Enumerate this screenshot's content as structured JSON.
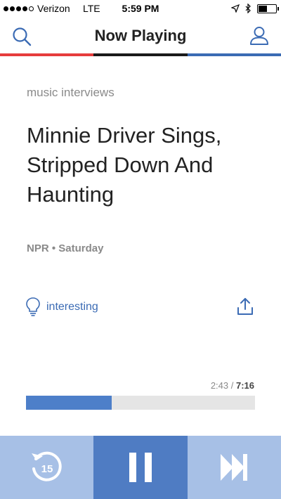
{
  "status_bar": {
    "carrier": "Verizon",
    "network": "LTE",
    "time": "5:59 PM",
    "signal_bars": 4,
    "battery_level": 0.45
  },
  "nav": {
    "title": "Now Playing",
    "search_icon": "search-icon",
    "user_icon": "user-icon",
    "stripe_colors": [
      "#e63c3c",
      "#1a1a1a",
      "#3b6bb4"
    ]
  },
  "story": {
    "category": "music interviews",
    "title": "Minnie Driver Sings, Stripped Down And Haunting",
    "meta": "NPR • Saturday"
  },
  "actions": {
    "rating_label": "interesting",
    "rating_icon": "lightbulb-icon",
    "share_icon": "share-icon"
  },
  "player": {
    "elapsed": "2:43",
    "separator": " / ",
    "total": "7:16",
    "progress": 0.374,
    "rewind_icon": "rewind-15-icon",
    "rewind_seconds": "15",
    "pause_icon": "pause-icon",
    "skip_icon": "skip-forward-icon"
  },
  "colors": {
    "accent": "#3b6bb4",
    "progress": "#4d7fc9",
    "control_light": "#a7c0e6",
    "control_dark": "#4f7cc3"
  }
}
